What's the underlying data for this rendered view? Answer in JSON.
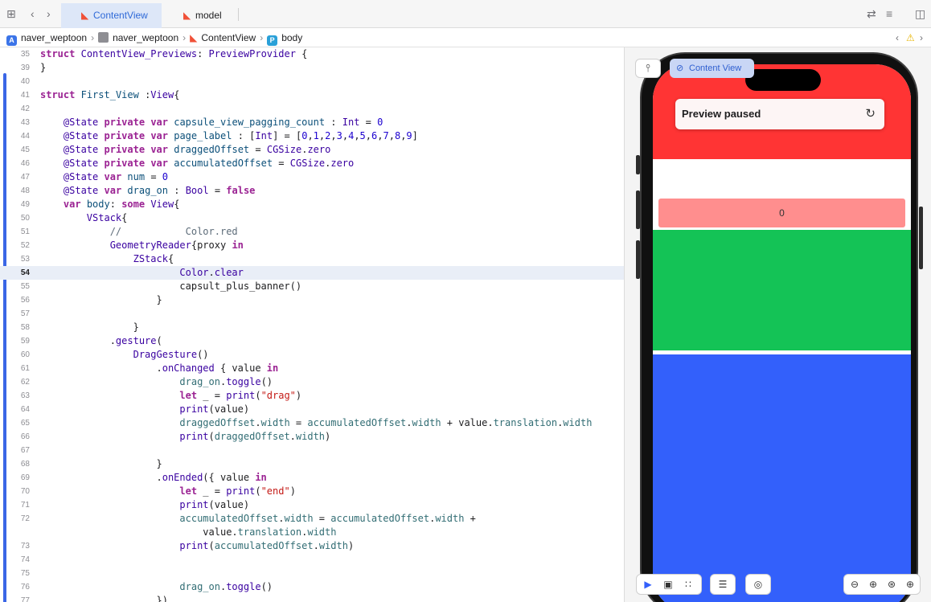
{
  "tabs": [
    {
      "label": "ContentView",
      "active": true
    },
    {
      "label": "model",
      "active": false
    }
  ],
  "breadcrumb": [
    "naver_weptoon",
    "naver_weptoon",
    "ContentView",
    "body"
  ],
  "code_lines": [
    {
      "n": "35",
      "html": "<span class=\"k\">struct</span> <span class=\"ty\">ContentView_Previews</span>: <span class=\"ty\">PreviewProvider</span> {"
    },
    {
      "n": "39",
      "html": "}"
    },
    {
      "n": "40",
      "html": ""
    },
    {
      "n": "41",
      "html": "<span class=\"k\">struct</span> <span class=\"t\">First_View</span> :<span class=\"ty\">View</span>{"
    },
    {
      "n": "42",
      "html": ""
    },
    {
      "n": "43",
      "html": "    <span class=\"ty\">@State</span> <span class=\"k\">private</span> <span class=\"k\">var</span> <span class=\"t\">capsule_view_pagging_count</span> : <span class=\"ty\">Int</span> = <span class=\"n\">0</span>"
    },
    {
      "n": "44",
      "html": "    <span class=\"ty\">@State</span> <span class=\"k\">private</span> <span class=\"k\">var</span> <span class=\"t\">page_label</span> : [<span class=\"ty\">Int</span>] = [<span class=\"n\">0</span>,<span class=\"n\">1</span>,<span class=\"n\">2</span>,<span class=\"n\">3</span>,<span class=\"n\">4</span>,<span class=\"n\">5</span>,<span class=\"n\">6</span>,<span class=\"n\">7</span>,<span class=\"n\">8</span>,<span class=\"n\">9</span>]"
    },
    {
      "n": "45",
      "html": "    <span class=\"ty\">@State</span> <span class=\"k\">private</span> <span class=\"k\">var</span> <span class=\"t\">draggedOffset</span> = <span class=\"ty\">CGSize</span>.<span class=\"ty\">zero</span>"
    },
    {
      "n": "46",
      "html": "    <span class=\"ty\">@State</span> <span class=\"k\">private</span> <span class=\"k\">var</span> <span class=\"t\">accumulatedOffset</span> = <span class=\"ty\">CGSize</span>.<span class=\"ty\">zero</span>"
    },
    {
      "n": "47",
      "html": "    <span class=\"ty\">@State</span> <span class=\"k\">var</span> <span class=\"t\">num</span> = <span class=\"n\">0</span>"
    },
    {
      "n": "48",
      "html": "    <span class=\"ty\">@State</span> <span class=\"k\">var</span> <span class=\"t\">drag_on</span> : <span class=\"ty\">Bool</span> = <span class=\"k\">false</span>"
    },
    {
      "n": "49",
      "html": "    <span class=\"k\">var</span> <span class=\"t\">body</span>: <span class=\"k\">some</span> <span class=\"ty\">View</span>{"
    },
    {
      "n": "50",
      "html": "        <span class=\"ty\">VStack</span>{"
    },
    {
      "n": "51",
      "html": "            <span class=\"c\">//           Color.red</span>"
    },
    {
      "n": "52",
      "html": "            <span class=\"ty\">GeometryReader</span>{proxy <span class=\"k\">in</span>"
    },
    {
      "n": "53",
      "html": "                <span class=\"ty\">ZStack</span>{"
    },
    {
      "n": "54",
      "html": "                        <span class=\"ty\">Color</span>.<span class=\"ty\">clear</span>",
      "current": true
    },
    {
      "n": "55",
      "html": "                        capsult_plus_banner()"
    },
    {
      "n": "56",
      "html": "                    }"
    },
    {
      "n": "57",
      "html": ""
    },
    {
      "n": "58",
      "html": "                }"
    },
    {
      "n": "59",
      "html": "            .<span class=\"ty\">gesture</span>("
    },
    {
      "n": "60",
      "html": "                <span class=\"ty\">DragGesture</span>()"
    },
    {
      "n": "61",
      "html": "                    .<span class=\"ty\">onChanged</span> { value <span class=\"k\">in</span>"
    },
    {
      "n": "62",
      "html": "                        <span class=\"v\">drag_on</span>.<span class=\"ty\">toggle</span>()"
    },
    {
      "n": "63",
      "html": "                        <span class=\"k\">let</span> _ = <span class=\"ty\">print</span>(<span class=\"s\">\"drag\"</span>)"
    },
    {
      "n": "64",
      "html": "                        <span class=\"ty\">print</span>(value)"
    },
    {
      "n": "65",
      "html": "                        <span class=\"v\">draggedOffset</span>.<span class=\"v\">width</span> = <span class=\"v\">accumulatedOffset</span>.<span class=\"v\">width</span> + value.<span class=\"v\">translation</span>.<span class=\"v\">width</span>"
    },
    {
      "n": "66",
      "html": "                        <span class=\"ty\">print</span>(<span class=\"v\">draggedOffset</span>.<span class=\"v\">width</span>)"
    },
    {
      "n": "67",
      "html": ""
    },
    {
      "n": "68",
      "html": "                    }"
    },
    {
      "n": "69",
      "html": "                    .<span class=\"ty\">onEnded</span>({ value <span class=\"k\">in</span>"
    },
    {
      "n": "70",
      "html": "                        <span class=\"k\">let</span> _ = <span class=\"ty\">print</span>(<span class=\"s\">\"end\"</span>)"
    },
    {
      "n": "71",
      "html": "                        <span class=\"ty\">print</span>(value)"
    },
    {
      "n": "72",
      "html": "                        <span class=\"v\">accumulatedOffset</span>.<span class=\"v\">width</span> = <span class=\"v\">accumulatedOffset</span>.<span class=\"v\">width</span> +"
    },
    {
      "n": "",
      "html": "                            value.<span class=\"v\">translation</span>.<span class=\"v\">width</span>"
    },
    {
      "n": "73",
      "html": "                        <span class=\"ty\">print</span>(<span class=\"v\">accumulatedOffset</span>.<span class=\"v\">width</span>)"
    },
    {
      "n": "74",
      "html": ""
    },
    {
      "n": "75",
      "html": ""
    },
    {
      "n": "76",
      "html": "                        <span class=\"v\">drag_on</span>.<span class=\"ty\">toggle</span>()"
    },
    {
      "n": "77",
      "html": "                    })"
    }
  ],
  "preview": {
    "chip_label": "Content View",
    "paused_text": "Preview paused",
    "capsule_text": "0"
  },
  "colors": {
    "red": "#ff3434",
    "green": "#14c356",
    "blue": "#3360fb",
    "capsule": "#ff8e8e",
    "accent": "#2f6ad8"
  },
  "icons": [
    "grid-icon",
    "back-icon",
    "forward-icon",
    "swift-icon",
    "swap-icon",
    "lines-icon",
    "inspector-icon",
    "app-icon",
    "folder-icon",
    "property-icon",
    "warning-icon",
    "pin-icon",
    "refresh-icon",
    "live-icon",
    "selectable-icon",
    "variants-icon",
    "device-settings-icon",
    "zoom-out-icon",
    "zoom-in-icon"
  ]
}
